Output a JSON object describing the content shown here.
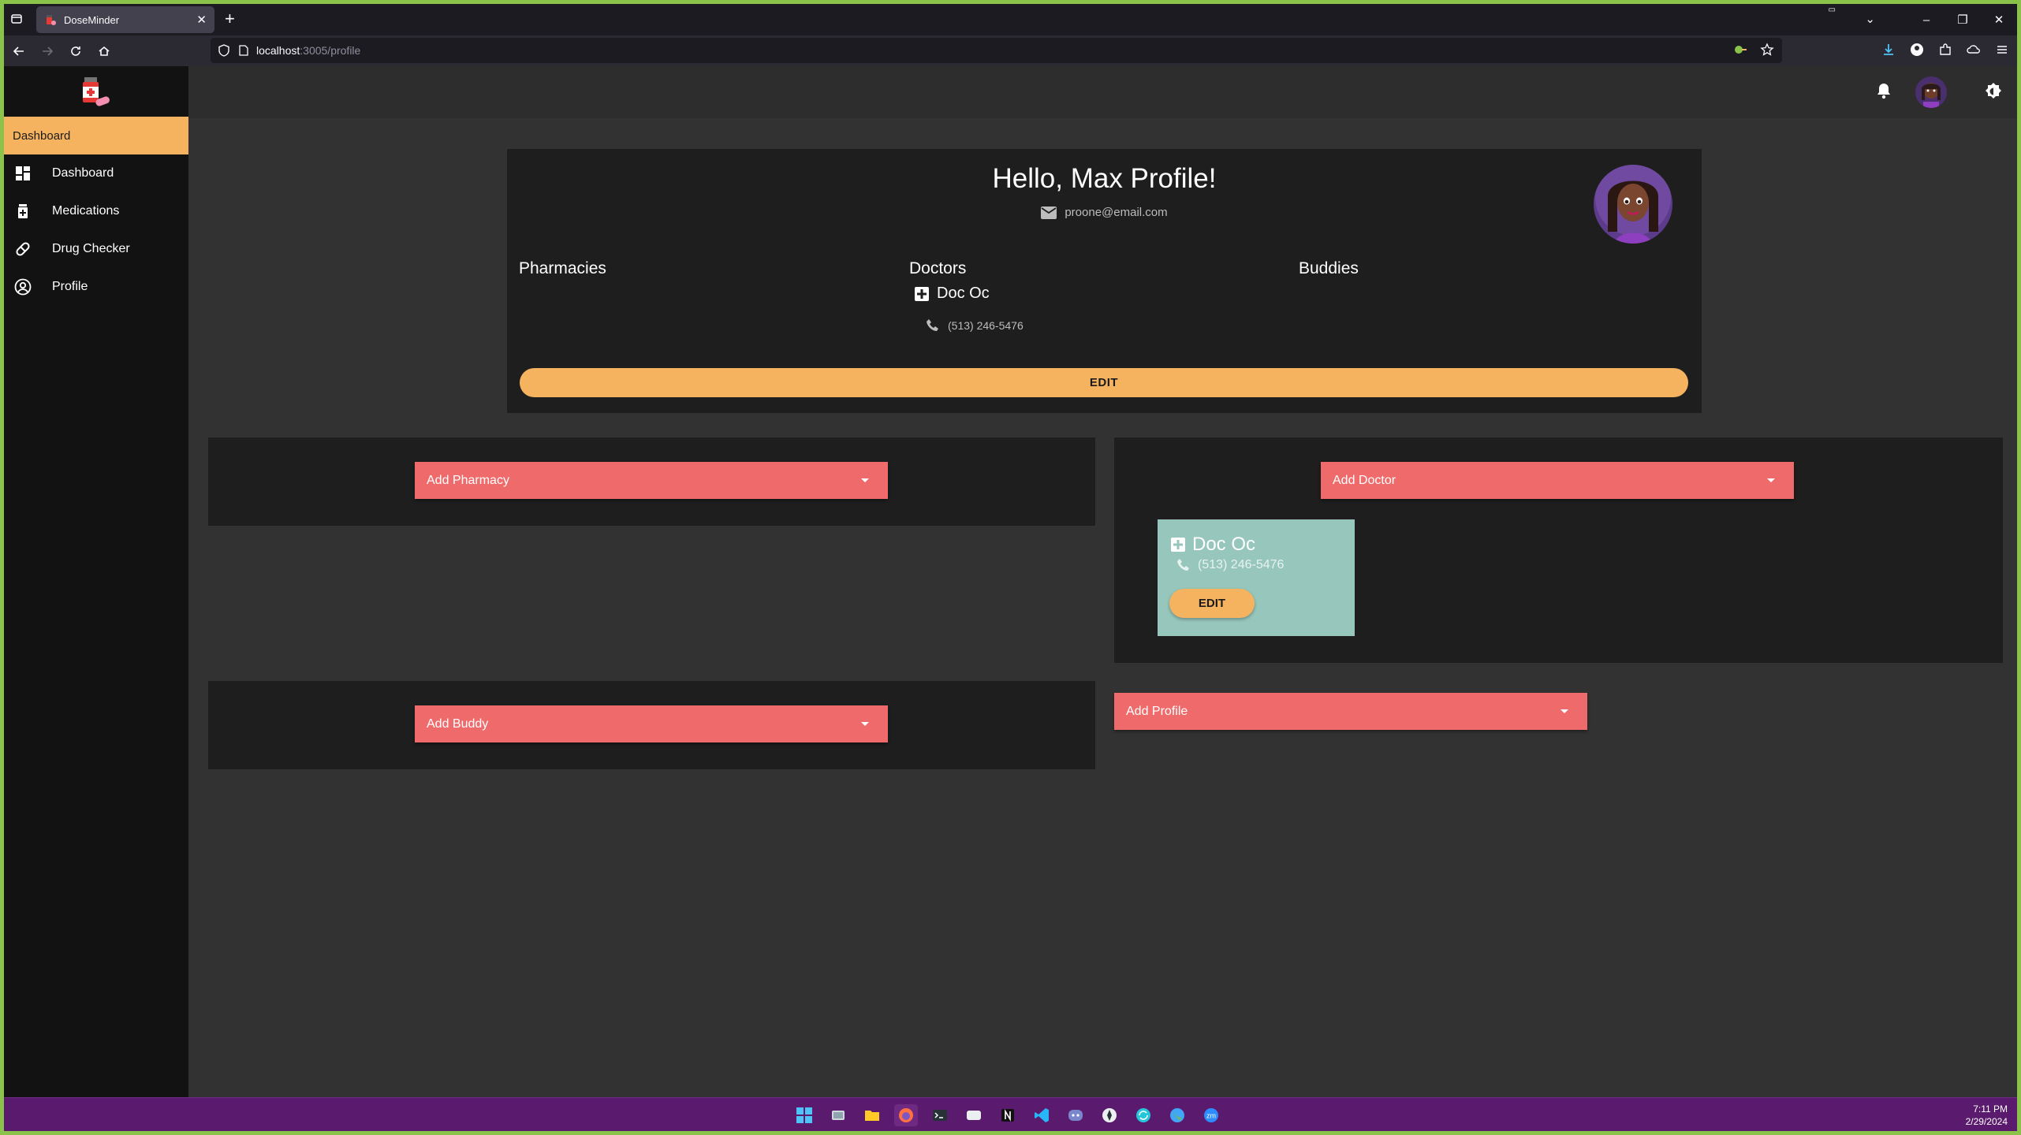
{
  "browser": {
    "tab_title": "DoseMinder",
    "url_host": "localhost",
    "url_path": ":3005/profile",
    "new_tab_label": "+",
    "tab_close": "✕"
  },
  "sidebar": {
    "header": "Dashboard",
    "items": [
      {
        "label": "Dashboard",
        "icon": "dashboard-icon"
      },
      {
        "label": "Medications",
        "icon": "medication-icon"
      },
      {
        "label": "Drug Checker",
        "icon": "pill-icon"
      },
      {
        "label": "Profile",
        "icon": "account-circle-icon"
      }
    ]
  },
  "profile": {
    "greeting": "Hello, Max Profile!",
    "email": "proone@email.com",
    "pharmacies_heading": "Pharmacies",
    "doctors_heading": "Doctors",
    "buddies_heading": "Buddies",
    "doctor_name": "Doc Oc",
    "doctor_phone": "(513) 246-5476",
    "edit_label": "EDIT"
  },
  "sections": {
    "add_pharmacy": "Add Pharmacy",
    "add_doctor": "Add Doctor",
    "add_buddy": "Add Buddy",
    "add_profile": "Add Profile"
  },
  "doctor_card": {
    "name": "Doc Oc",
    "phone": "(513) 246-5476",
    "edit_label": "EDIT"
  },
  "taskbar": {
    "time": "7:11 PM",
    "date": "2/29/2024",
    "zoom_label": "zm"
  },
  "colors": {
    "accent_orange": "#f6b35f",
    "select_red": "#ef6b6b",
    "card_teal": "#97c7bc",
    "sidebar_bg": "#121212",
    "taskbar_purple": "#5a1a6d"
  }
}
